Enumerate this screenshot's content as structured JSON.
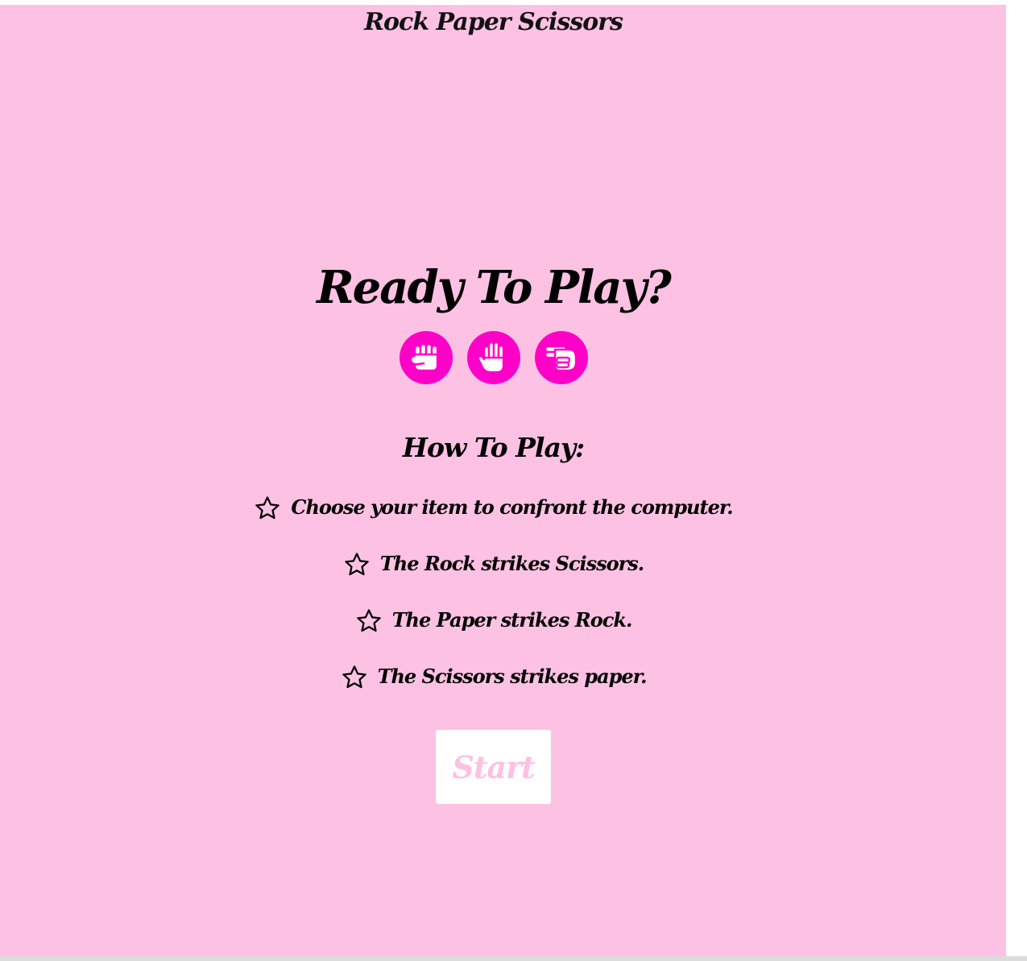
{
  "header": {
    "title": "Rock Paper Scissors"
  },
  "intro": {
    "headline": "Ready To Play?"
  },
  "choices": [
    {
      "name": "rock",
      "icon": "fist-icon"
    },
    {
      "name": "paper",
      "icon": "open-hand-icon"
    },
    {
      "name": "scissors",
      "icon": "scissors-hand-icon"
    }
  ],
  "how_to_play": {
    "title": "How To Play:",
    "rules": [
      "Choose your item to confront the computer.",
      "The Rock strikes Scissors.",
      "The Paper strikes Rock.",
      "The Scissors strikes paper."
    ]
  },
  "start_button": {
    "label": "Start"
  },
  "colors": {
    "background": "#fdc1e3",
    "accent": "#ff00c8",
    "button_bg": "#ffffff"
  }
}
